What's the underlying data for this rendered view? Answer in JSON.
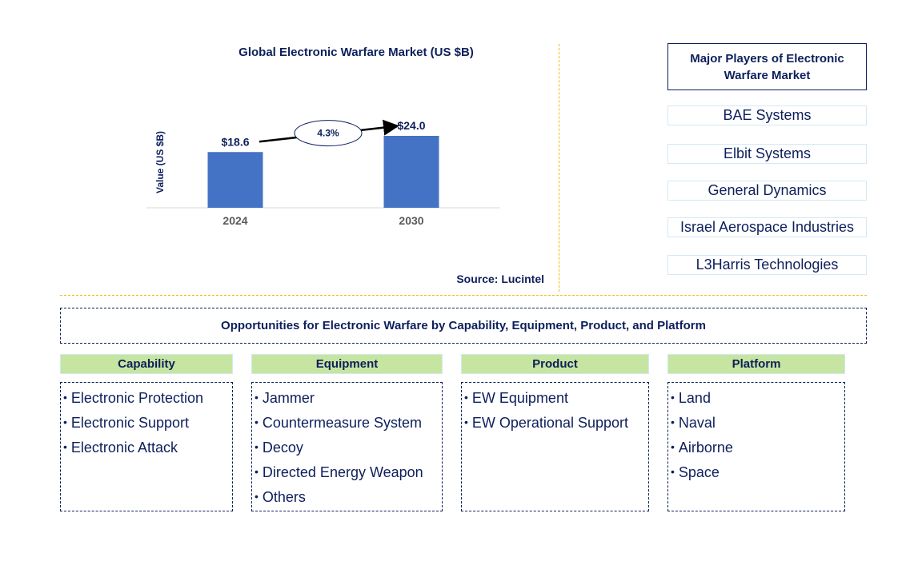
{
  "chart_data": {
    "type": "bar",
    "title": "Global Electronic Warfare Market (US $B)",
    "xlabel": "",
    "ylabel": "Value (US $B)",
    "categories": [
      "2024",
      "2030"
    ],
    "values": [
      18.6,
      24.0
    ],
    "data_labels": [
      "$18.6",
      "$24.0"
    ],
    "ylim": [
      0,
      30
    ],
    "grid": false,
    "bar_color": "#4472c4",
    "annotations": [
      {
        "type": "cagr-arrow",
        "from": "2024",
        "to": "2030",
        "label": "4.3%"
      }
    ]
  },
  "source": "Source: Lucintel",
  "players": {
    "title": "Major Players of Electronic Warfare Market",
    "items": [
      "BAE Systems",
      "Elbit Systems",
      "General Dynamics",
      "Israel Aerospace Industries",
      "L3Harris Technologies"
    ]
  },
  "opportunities": {
    "title": "Opportunities for Electronic Warfare by Capability, Equipment, Product, and Platform",
    "categories": [
      {
        "name": "Capability",
        "items": [
          "Electronic Protection",
          "Electronic Support",
          "Electronic Attack"
        ]
      },
      {
        "name": "Equipment",
        "items": [
          "Jammer",
          "Countermeasure System",
          "Decoy",
          "Directed Energy Weapon",
          "Others"
        ]
      },
      {
        "name": "Product",
        "items": [
          "EW Equipment",
          "EW Operational Support"
        ]
      },
      {
        "name": "Platform",
        "items": [
          "Land",
          "Naval",
          "Airborne",
          "Space"
        ]
      }
    ]
  },
  "colors": {
    "text": "#0d1f5c",
    "bar": "#4472c4",
    "divider": "#f5b800",
    "category_header": "#c6e5a0"
  }
}
